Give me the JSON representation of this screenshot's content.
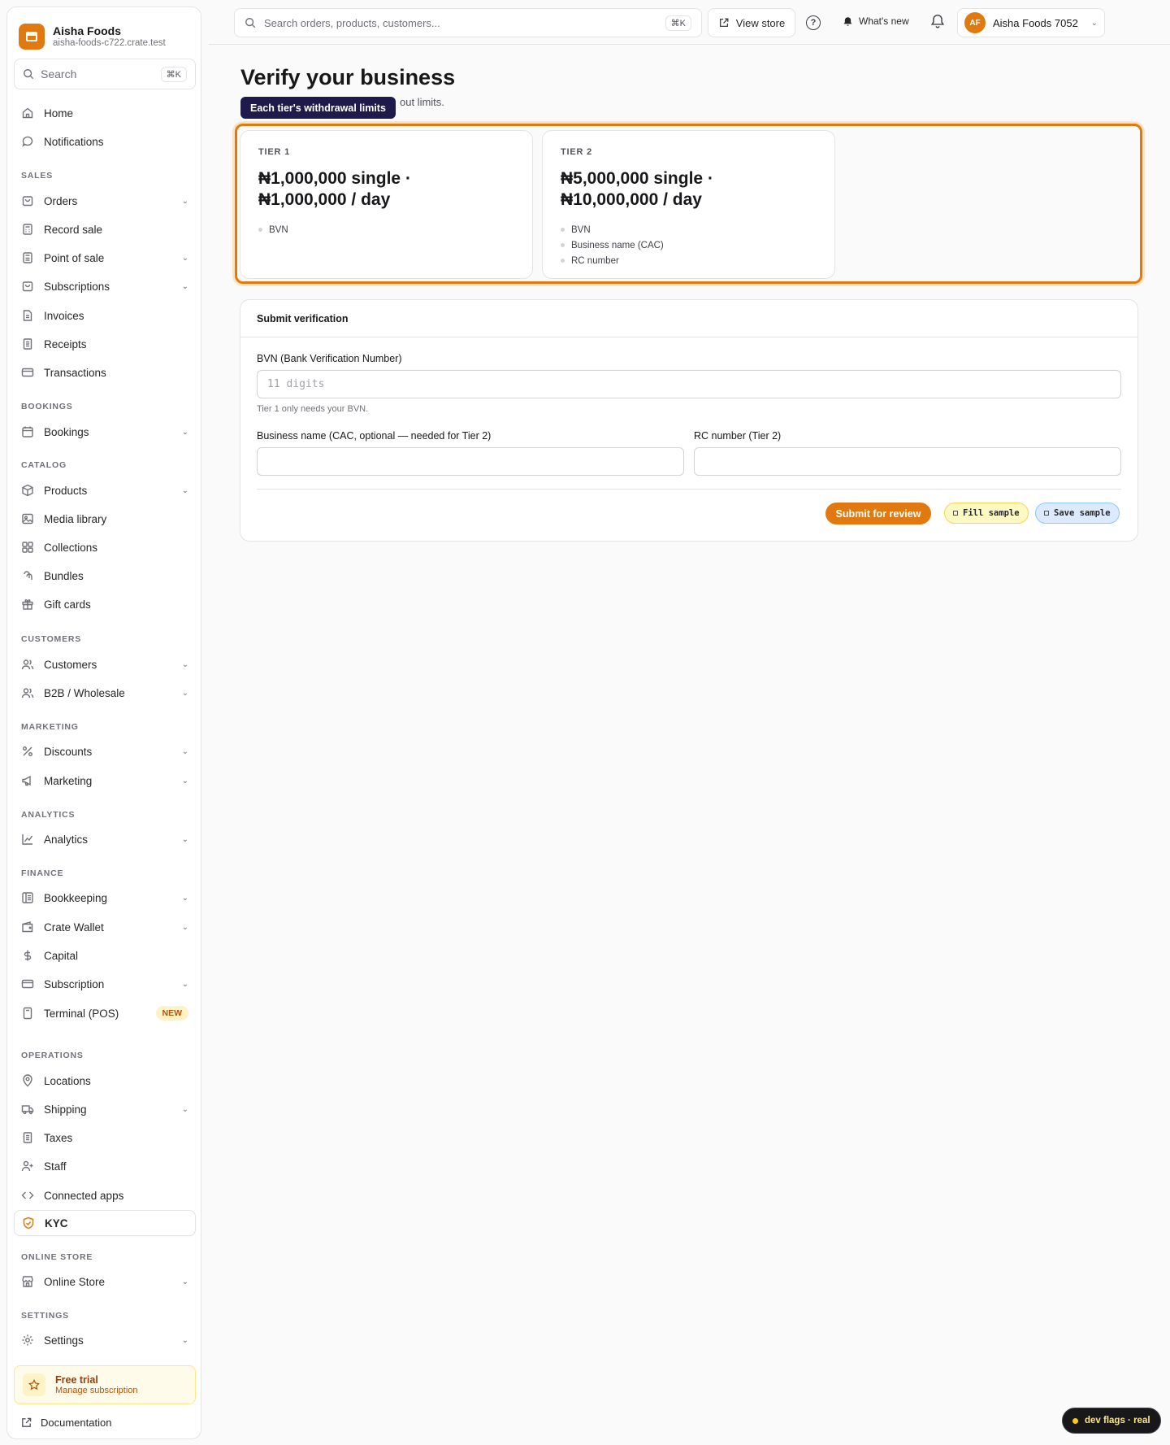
{
  "brand": {
    "name": "Aisha Foods",
    "domain": "aisha-foods-c722.crate.test"
  },
  "sidebar": {
    "search_placeholder": "Search",
    "search_shortcut": "⌘K",
    "items": [
      {
        "label": "Home"
      },
      {
        "label": "Notifications"
      },
      {
        "label": "Orders"
      },
      {
        "label": "Record sale"
      },
      {
        "label": "Point of sale"
      },
      {
        "label": "Subscriptions"
      },
      {
        "label": "Invoices"
      },
      {
        "label": "Receipts"
      },
      {
        "label": "Transactions"
      },
      {
        "label": "Bookings"
      },
      {
        "label": "Products"
      },
      {
        "label": "Media library"
      },
      {
        "label": "Collections"
      },
      {
        "label": "Bundles"
      },
      {
        "label": "Gift cards"
      },
      {
        "label": "Customers"
      },
      {
        "label": "B2B / Wholesale"
      },
      {
        "label": "Discounts"
      },
      {
        "label": "Marketing"
      },
      {
        "label": "Analytics"
      },
      {
        "label": "Bookkeeping"
      },
      {
        "label": "Crate Wallet"
      },
      {
        "label": "Capital"
      },
      {
        "label": "Subscription"
      },
      {
        "label": "Terminal (POS)",
        "badge": "NEW"
      },
      {
        "label": "Locations"
      },
      {
        "label": "Shipping"
      },
      {
        "label": "Taxes"
      },
      {
        "label": "Staff"
      },
      {
        "label": "Connected apps"
      },
      {
        "label": "KYC"
      },
      {
        "label": "Online Store"
      },
      {
        "label": "Settings"
      }
    ],
    "sections": [
      "SALES",
      "BOOKINGS",
      "CATALOG",
      "CUSTOMERS",
      "MARKETING",
      "ANALYTICS",
      "FINANCE",
      "OPERATIONS",
      "ONLINE STORE",
      "SETTINGS"
    ],
    "trial": {
      "title": "Free trial",
      "subtitle": "Manage subscription"
    },
    "docs_label": "Documentation"
  },
  "topbar": {
    "search_placeholder": "Search orders, products, customers...",
    "search_shortcut": "⌘K",
    "view_store": "View store",
    "help_glyph": "?",
    "whats_new": "What's new",
    "account_initials": "AF",
    "account_name": "Aisha Foods 7052"
  },
  "page": {
    "title": "Verify your business",
    "subtitle_visible": "out limits.",
    "tooltip": "Each tier's withdrawal limits"
  },
  "tiers": [
    {
      "label": "TIER 1",
      "limits": "₦1,000,000 single · ₦1,000,000 / day",
      "requirements": [
        "BVN"
      ]
    },
    {
      "label": "TIER 2",
      "limits": "₦5,000,000 single · ₦10,000,000 / day",
      "requirements": [
        "BVN",
        "Business name (CAC)",
        "RC number"
      ]
    }
  ],
  "form": {
    "heading": "Submit verification",
    "bvn_label": "BVN (Bank Verification Number)",
    "bvn_placeholder": "11 digits",
    "bvn_hint": "Tier 1 only needs your BVN.",
    "business_label": "Business name (CAC, optional — needed for Tier 2)",
    "rc_label": "RC number (Tier 2)",
    "submit_label": "Submit for review",
    "fill_sample": "Fill sample",
    "save_sample": "Save sample"
  },
  "dev_flags": "dev flags · real",
  "colors": {
    "accent": "#e07a10",
    "tooltip_bg": "#1e1b4b"
  }
}
